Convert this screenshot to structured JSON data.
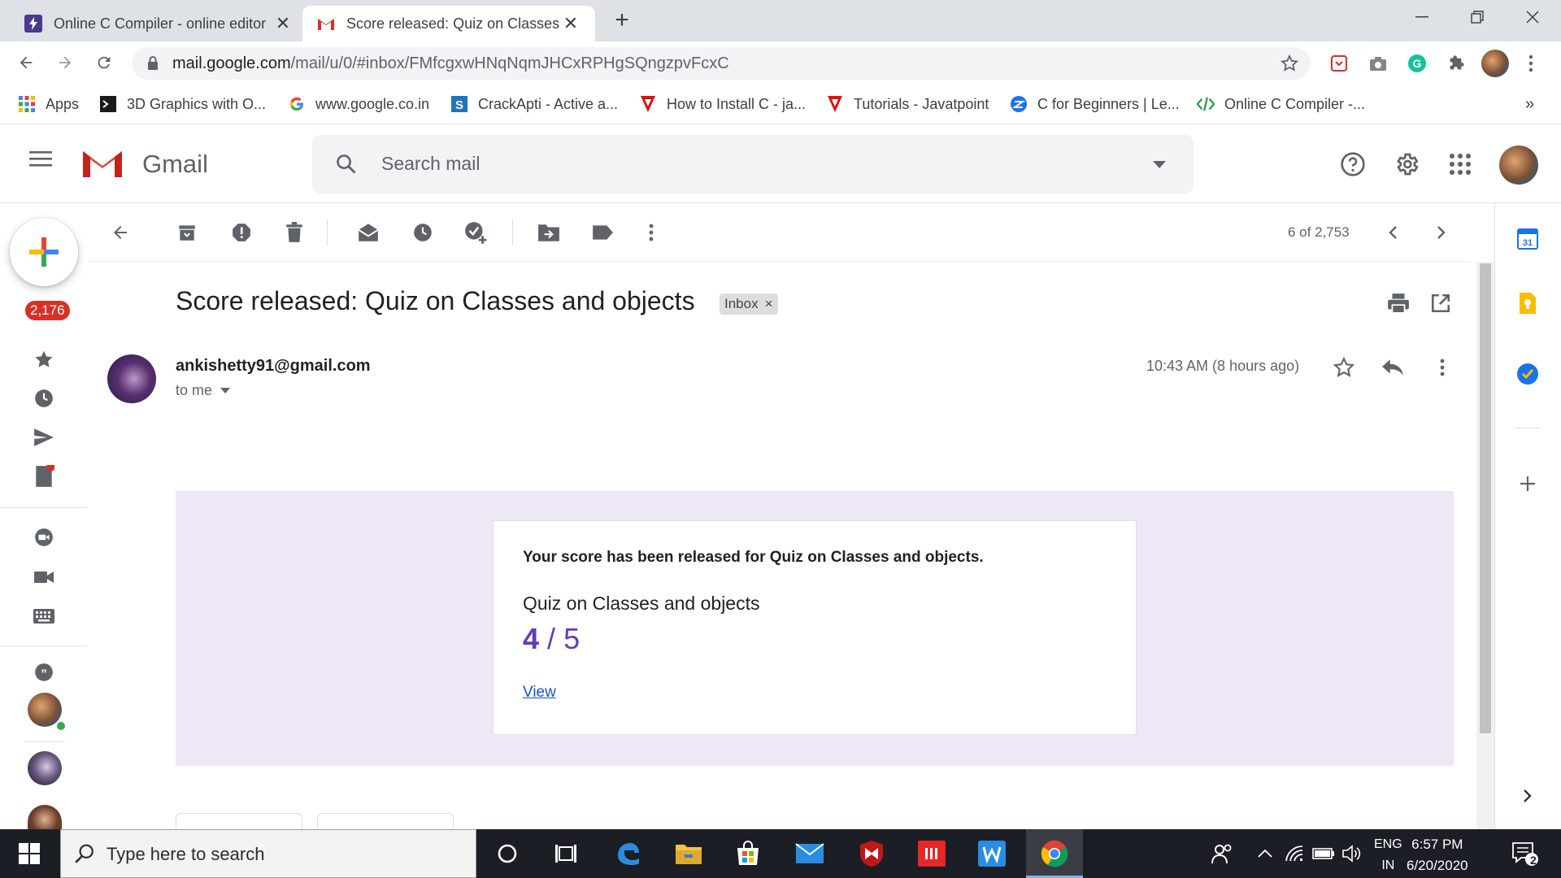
{
  "browser": {
    "tabs": [
      {
        "title": "Online C Compiler - online editor",
        "active": false
      },
      {
        "title": "Score released: Quiz on Classes a",
        "active": true
      }
    ],
    "url_host": "mail.google.com",
    "url_path": "/mail/u/0/#inbox/FMfcgxwHNqNqmJHCxRPHgSQngzpvFcxC"
  },
  "bookmarks": [
    {
      "label": "Apps",
      "icon": "apps-grid-icon"
    },
    {
      "label": "3D Graphics with O...",
      "icon": "terminal-icon"
    },
    {
      "label": "www.google.co.in",
      "icon": "google-g-icon"
    },
    {
      "label": "CrackApti - Active a...",
      "icon": "crackapti-icon"
    },
    {
      "label": "How to Install C - ja...",
      "icon": "javatpoint-icon"
    },
    {
      "label": "Tutorials - Javatpoint",
      "icon": "javatpoint-icon"
    },
    {
      "label": "C for Beginners | Le...",
      "icon": "learn-icon"
    },
    {
      "label": "Online C Compiler -...",
      "icon": "code-icon"
    }
  ],
  "gmail": {
    "brand": "Gmail",
    "search_placeholder": "Search mail",
    "unread_badge": "2,176",
    "pagination": "6 of 2,753"
  },
  "message": {
    "subject": "Score released: Quiz on Classes and objects",
    "label_chip": "Inbox",
    "chip_close": "×",
    "from": "ankishetty91@gmail.com",
    "to": "to me",
    "time": "10:43 AM (8 hours ago)",
    "body": {
      "released_text": "Your score has been released for Quiz on Classes and objects.",
      "quiz_title": "Quiz on Classes and objects",
      "score": "4",
      "score_sep": "/",
      "score_total": "5",
      "view_link": "View"
    }
  },
  "taskbar": {
    "search_placeholder": "Type here to search",
    "lang_top": "ENG",
    "lang_bottom": "IN",
    "time": "6:57 PM",
    "date": "6/20/2020",
    "notifications": "2"
  },
  "colors": {
    "score_purple": "#673ab7",
    "card_background": "#ede7f6",
    "badge_red": "#d93025",
    "link_blue": "#1155cc"
  }
}
